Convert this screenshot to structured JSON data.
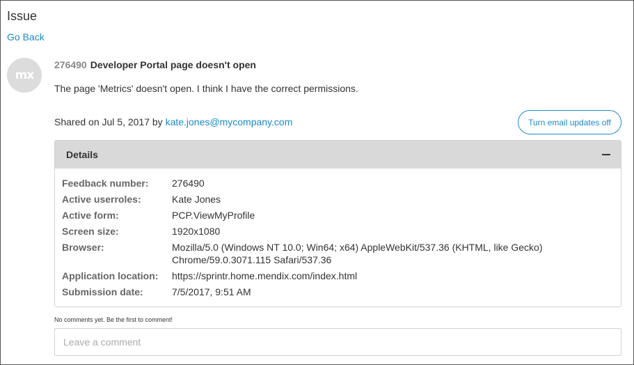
{
  "page": {
    "title": "Issue",
    "go_back": "Go Back"
  },
  "avatar": {
    "text": "mx"
  },
  "issue": {
    "number": "276490",
    "title": "Developer Portal page doesn't open",
    "description": "The page 'Metrics' doesn't open. I think I have the correct permissions.",
    "shared_prefix": "Shared on Jul 5, 2017 by",
    "shared_email": "kate.jones@mycompany.com"
  },
  "email_button": {
    "label": "Turn email updates off"
  },
  "details": {
    "title": "Details",
    "rows": [
      {
        "label": "Feedback number:",
        "value": "276490"
      },
      {
        "label": "Active userroles:",
        "value": "Kate Jones"
      },
      {
        "label": "Active form:",
        "value": "PCP.ViewMyProfile"
      },
      {
        "label": "Screen size:",
        "value": "1920x1080"
      },
      {
        "label": "Browser:",
        "value": "Mozilla/5.0 (Windows NT 10.0; Win64; x64) AppleWebKit/537.36 (KHTML, like Gecko) Chrome/59.0.3071.115 Safari/537.36"
      },
      {
        "label": "Application location:",
        "value": "https://sprintr.home.mendix.com/index.html"
      },
      {
        "label": "Submission date:",
        "value": "7/5/2017, 9:51 AM"
      }
    ]
  },
  "comments": {
    "empty_message": "No comments yet. Be the first to comment!",
    "placeholder": "Leave a comment"
  },
  "colors": {
    "link": "#1a8bc9",
    "header_bg": "#d9d9d9",
    "label": "#666666"
  }
}
